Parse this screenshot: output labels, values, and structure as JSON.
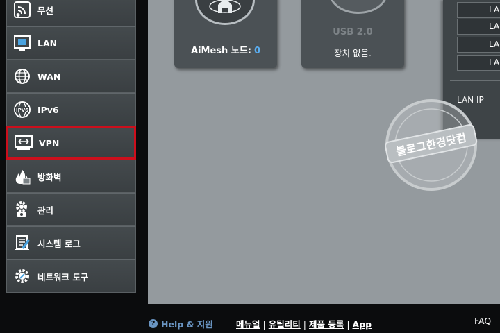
{
  "sidebar": {
    "items": [
      {
        "label": "무선",
        "icon": "wireless-icon"
      },
      {
        "label": "LAN",
        "icon": "lan-icon"
      },
      {
        "label": "WAN",
        "icon": "globe-icon"
      },
      {
        "label": "IPv6",
        "icon": "ipv6-icon"
      },
      {
        "label": "VPN",
        "icon": "vpn-icon",
        "selected": true
      },
      {
        "label": "방화벽",
        "icon": "firewall-icon"
      },
      {
        "label": "관리",
        "icon": "admin-gear-icon"
      },
      {
        "label": "시스템 로그",
        "icon": "system-log-icon"
      },
      {
        "label": "네트워크 도구",
        "icon": "network-tools-icon"
      }
    ]
  },
  "main": {
    "aimesh": {
      "label": "AiMesh 노드:",
      "count": "0"
    },
    "usb": {
      "title": "USB 2.0",
      "status": "장치 없음."
    },
    "lan_ports": [
      "LA",
      "LA",
      "LA",
      "LA"
    ],
    "lan_ip_label": "LAN IP"
  },
  "watermark": {
    "text": "블로그한경닷컴"
  },
  "footer": {
    "help_label": "Help & 지원",
    "links": [
      "메뉴얼",
      "유틸리티",
      "제품 등록",
      "App"
    ],
    "faq_label": "FAQ"
  },
  "colors": {
    "accent": "#5aaef2",
    "selected_border": "#cc0f1c",
    "help_link": "#6a95c2"
  }
}
